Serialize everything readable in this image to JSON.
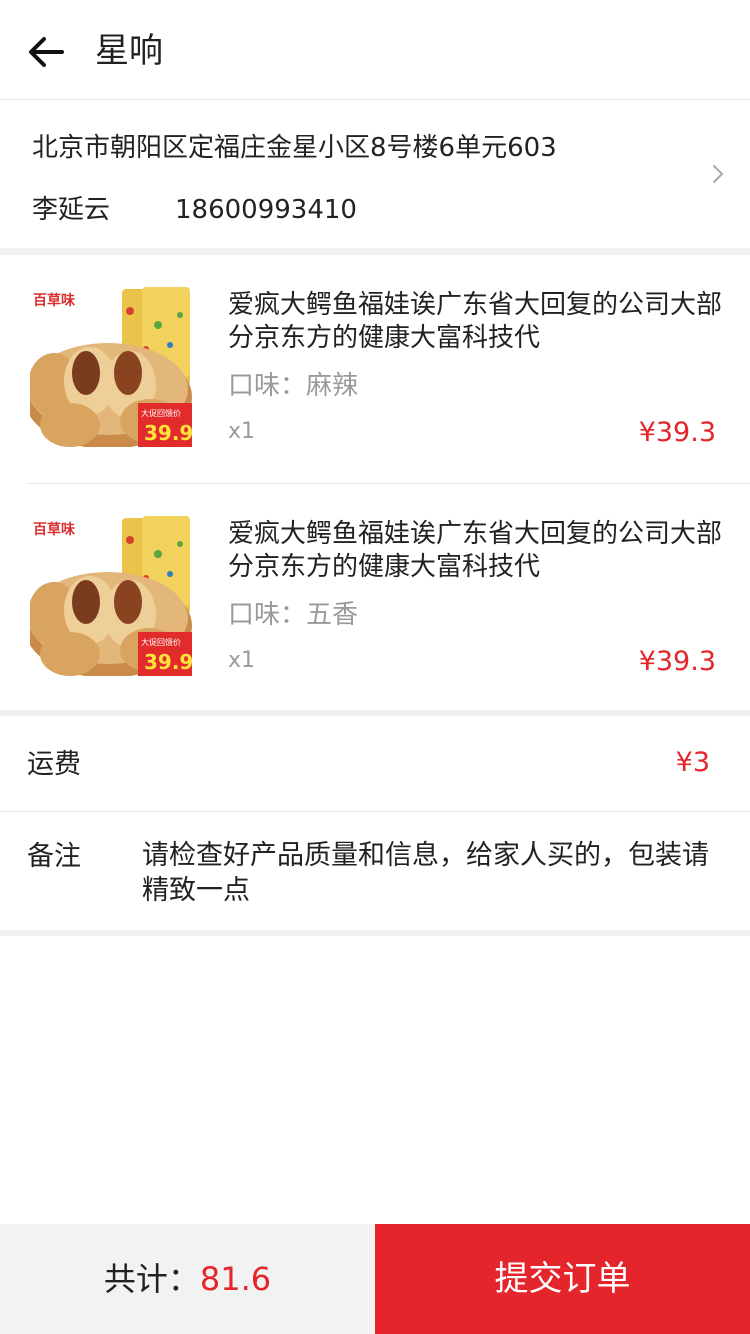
{
  "header": {
    "title": "星响"
  },
  "address": {
    "line": "北京市朝阳区定福庄金星小区8号楼6单元603",
    "name": "李延云",
    "phone": "18600993410"
  },
  "products": [
    {
      "name": "爱疯大鳄鱼福娃诶广东省大回复的公司大部分京东方的健康大富科技代",
      "flavor": "口味：麻辣",
      "qty": "x1",
      "price": "¥39.3",
      "image_logo": "百草味",
      "image_badge": "大促回馈价",
      "image_price": "39.9"
    },
    {
      "name": "爱疯大鳄鱼福娃诶广东省大回复的公司大部分京东方的健康大富科技代",
      "flavor": "口味：五香",
      "qty": "x1",
      "price": "¥39.3",
      "image_logo": "百草味",
      "image_badge": "大促回馈价",
      "image_price": "39.9"
    }
  ],
  "shipping": {
    "label": "运费",
    "value": "¥3"
  },
  "remark": {
    "label": "备注",
    "text": "请检查好产品质量和信息，给家人买的，包装请精致一点"
  },
  "footer": {
    "total_label": "共计：",
    "total_value": "81.6",
    "submit_label": "提交订单"
  },
  "colors": {
    "accent": "#e4252b",
    "muted_text": "#9a9a9a",
    "footer_bg": "#f2f2f2"
  },
  "icons": {
    "back": "arrow-left-icon",
    "chevron": "chevron-right-icon"
  }
}
